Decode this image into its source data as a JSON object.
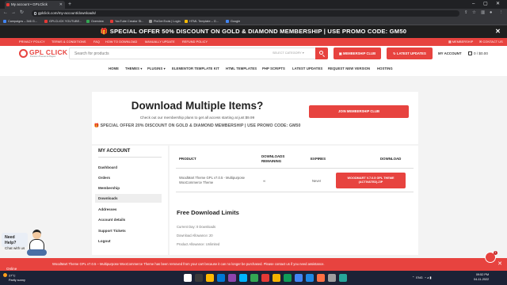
{
  "browser": {
    "tab_title": "My account • GPLClick",
    "new_tab_symbol": "+",
    "url": "gplclick.com/my-account/downloads/",
    "bookmarks": [
      {
        "label": "Campaigns – 346 G...",
        "color": "#4285f4"
      },
      {
        "label": "GPLCLICK YOUTUBE...",
        "color": "#e53935"
      },
      {
        "label": "Overview",
        "color": "#34a853"
      },
      {
        "label": "YouTube Creator St...",
        "color": "#e53935"
      },
      {
        "label": "PixGenTools | Login",
        "color": "#9e9e9e"
      },
      {
        "label": "HTML Template – G...",
        "color": "#fbbc04"
      },
      {
        "label": "Google",
        "color": "#4285f4"
      }
    ]
  },
  "promo": {
    "text": "🎁 SPECIAL OFFER 50% DISCOUNT ON GOLD & DIAMOND MEMBERSHIP | USE PROMO CODE: GM50",
    "close": "✕"
  },
  "toplinks": {
    "left": [
      "PRIVACY POLICY",
      "TERMS & CONDITIONS",
      "FAQ",
      "HOW TO DOWNLOAD",
      "MANUALLY UPDATE",
      "REFUND POLICY"
    ],
    "membership": "MEMBERSHIP",
    "contact": "CONTACT US"
  },
  "header": {
    "logo_text": "GPL CLICK",
    "logo_sub": "Premium Themes & Plugins",
    "search_placeholder": "Search for products",
    "select_category": "SELECT CATEGORY",
    "membership_club_btn": "MEMBERSHIP CLUB",
    "latest_updates_btn": "LATEST UPDATES",
    "my_account": "MY ACCOUNT",
    "cart": "0 / $0.00"
  },
  "nav": [
    "HOME",
    "THEMES",
    "PLUGINS",
    "ELEMENTOR TEMPLATE KIT",
    "HTML TEMPLATES",
    "PHP SCRIPTS",
    "LATEST UPDATES",
    "REQUEST NEW VERSION",
    "HOSTING"
  ],
  "hero": {
    "title": "Download Multiple Items?",
    "subtitle": "Check out our membership plans to get all access starting at just $9.99",
    "offer": "🎁 SPECIAL OFFER 20% DISCOUNT ON GOLD & DIAMOND MEMBERSHIP | USE PROMO CODE: GM50",
    "button": "JOIN MEMBERSHIP CLUB"
  },
  "sidebar": {
    "title": "MY ACCOUNT",
    "items": [
      "Dashboard",
      "Orders",
      "Membership",
      "Downloads",
      "Addresses",
      "Account details",
      "Support Tickets",
      "Logout"
    ],
    "active_index": 3
  },
  "downloads": {
    "headers": {
      "product": "PRODUCT",
      "remaining": "DOWNLOADS REMAINING",
      "expires": "EXPIRES",
      "download": "DOWNLOAD"
    },
    "rows": [
      {
        "product": "WoodMart Theme GPL v7.0.5 - Multipurpose WooCommerce Theme",
        "remaining": "∞",
        "expires": "Never",
        "button": "WOODMART V.7.0.5 GPL THEME (ACTIVATED).ZIP"
      }
    ]
  },
  "limits": {
    "title": "Free Download Limits",
    "current_day": "Current Day: 0 Downloads",
    "allowance": "Download Allowance: 20",
    "product_allowance": "Product Allowance: Unlimited"
  },
  "help": {
    "line1": "Need Help?",
    "line2": "Chat with us"
  },
  "notice": {
    "text": "WoodMart Theme GPL v7.0.5 – Multipurpose WooCommerce Theme has been removed from your cart because it can no longer be purchased. Please contact us if you need assistance.",
    "close": "✕",
    "badge_count": "1",
    "online": "Online"
  },
  "taskbar": {
    "temp": "27°C",
    "weather": "Partly sunny",
    "lang1": "ENG",
    "lang2": "IN",
    "time": "09:52 PM",
    "date": "04-11-2022",
    "app_colors": [
      "#ffffff",
      "#3a3a3a",
      "#ffb900",
      "#0078d4",
      "#8e44ad",
      "#00b4ff",
      "#34a853",
      "#e53935",
      "#f4b400",
      "#0f9d58",
      "#4285f4",
      "#1e88e5",
      "#ff7043",
      "#9e9e9e",
      "#26a69a"
    ]
  }
}
